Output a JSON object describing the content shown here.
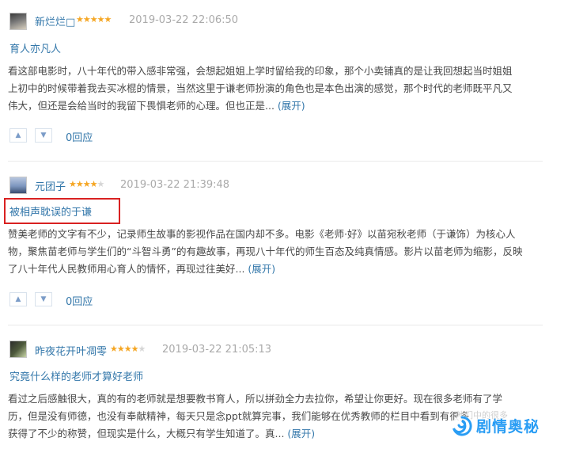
{
  "colors": {
    "link": "#3377aa",
    "star": "#f5a623",
    "highlight": "#d92121",
    "watermark": "#2a9df4"
  },
  "reviews": [
    {
      "author": "新烂烂□",
      "rating": 5,
      "date": "2019-03-22 22:06:50",
      "title": "育人亦凡人",
      "lines": [
        "看这部电影时，八十年代的带入感非常强，会想起姐姐上学时留给我的印象，那个小卖铺真的是让我回想起当时姐姐",
        "上初中的时候带着我去买冰棍的情景，当然这里于谦老师扮演的角色也是本色出演的感觉，那个时代的老师既平凡又",
        "伟大，但还是会给当时的我留下畏惧老师的心理。但也正是..."
      ],
      "expand_label": "(展开)",
      "up_icon": "thumbs-up-icon",
      "down_icon": "thumbs-down-icon",
      "replies_label": "0回应"
    },
    {
      "author": "元团子",
      "rating": 4,
      "date": "2019-03-22 21:39:48",
      "title": "被相声耽误的于谦",
      "lines": [
        "赞美老师的文字有不少，记录师生故事的影视作品在国内却不多。电影《老师·好》以苗宛秋老师（于谦饰）为核心人",
        "物，聚焦苗老师与学生们的“斗智斗勇”的有趣故事，再现八十年代的师生百态及纯真情感。影片以苗老师为缩影，反映",
        "了八十年代人民教师用心育人的情怀，再现过往美好..."
      ],
      "expand_label": "(展开)",
      "up_icon": "thumbs-up-icon",
      "down_icon": "thumbs-down-icon",
      "replies_label": "0回应"
    },
    {
      "author": "昨夜花开叶凋零",
      "rating": 4,
      "date": "2019-03-22 21:05:13",
      "title": "究竟什么样的老师才算好老师",
      "lines": [
        "看过之后感触很大，真的有的老师就是想要教书育人，所以拼劲全力去拉你，希望让你更好。现在很多老师有了学",
        "历，但是没有师德，也没有奉献精神，每天只是念ppt就算完事，我们能够在优秀教师的栏目中看到有很多",
        "获得了不少的称赞，但现实是什么，大概只有学生知道了。真..."
      ],
      "expand_label": "(展开)"
    }
  ],
  "watermark": {
    "text": "剧情奥秘",
    "faint_text": "他们中的很多",
    "logo_icon": "spiral-logo-icon"
  }
}
